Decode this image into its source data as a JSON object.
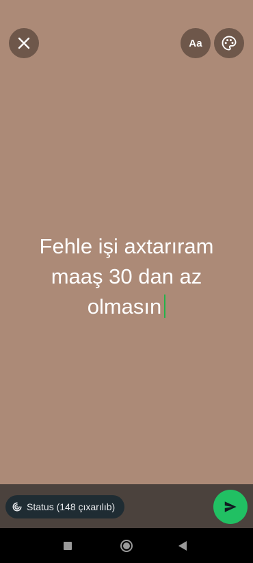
{
  "toolbar": {
    "close_icon": "close-icon",
    "font_label": "Aa",
    "palette_icon": "palette-icon"
  },
  "status_text": {
    "lines": [
      "Fehle işi axtarıram",
      "maaş 30 dan az",
      "olmasın"
    ],
    "caret_color": "#22b34a"
  },
  "colors": {
    "background": "#ac8a77",
    "send_button": "#21c063",
    "privacy_chip": "#1f2c33"
  },
  "footer": {
    "privacy_label": "Status (148 çıxarılıb)",
    "privacy_icon": "status-privacy-icon",
    "send_icon": "send-icon"
  },
  "navigation": {
    "recents_icon": "recents-icon",
    "home_icon": "home-icon",
    "back_icon": "back-icon"
  }
}
